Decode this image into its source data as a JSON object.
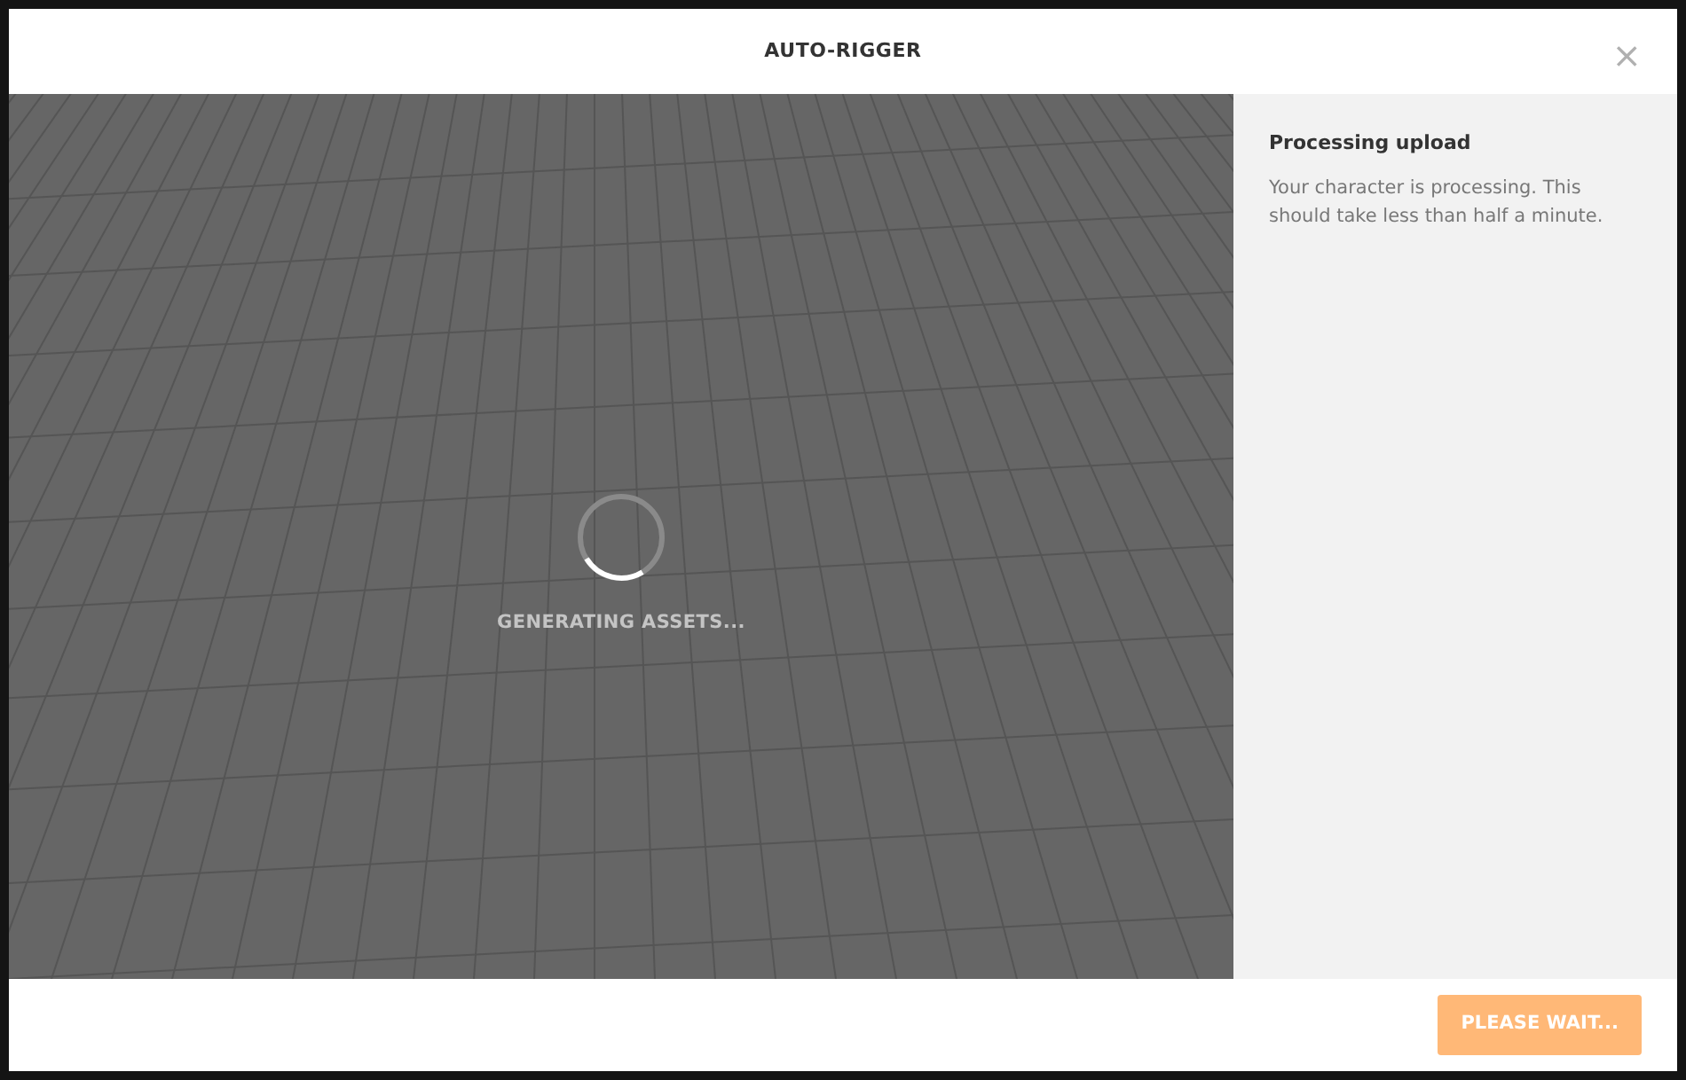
{
  "dialog": {
    "title": "AUTO-RIGGER",
    "close": "×"
  },
  "viewport": {
    "status": "GENERATING ASSETS...",
    "loading": true
  },
  "sidebar": {
    "heading": "Processing upload",
    "text": "Your character is processing. This should take less than half a minute."
  },
  "footer": {
    "button": {
      "label": "PLEASE WAIT...",
      "disabled": true
    }
  }
}
